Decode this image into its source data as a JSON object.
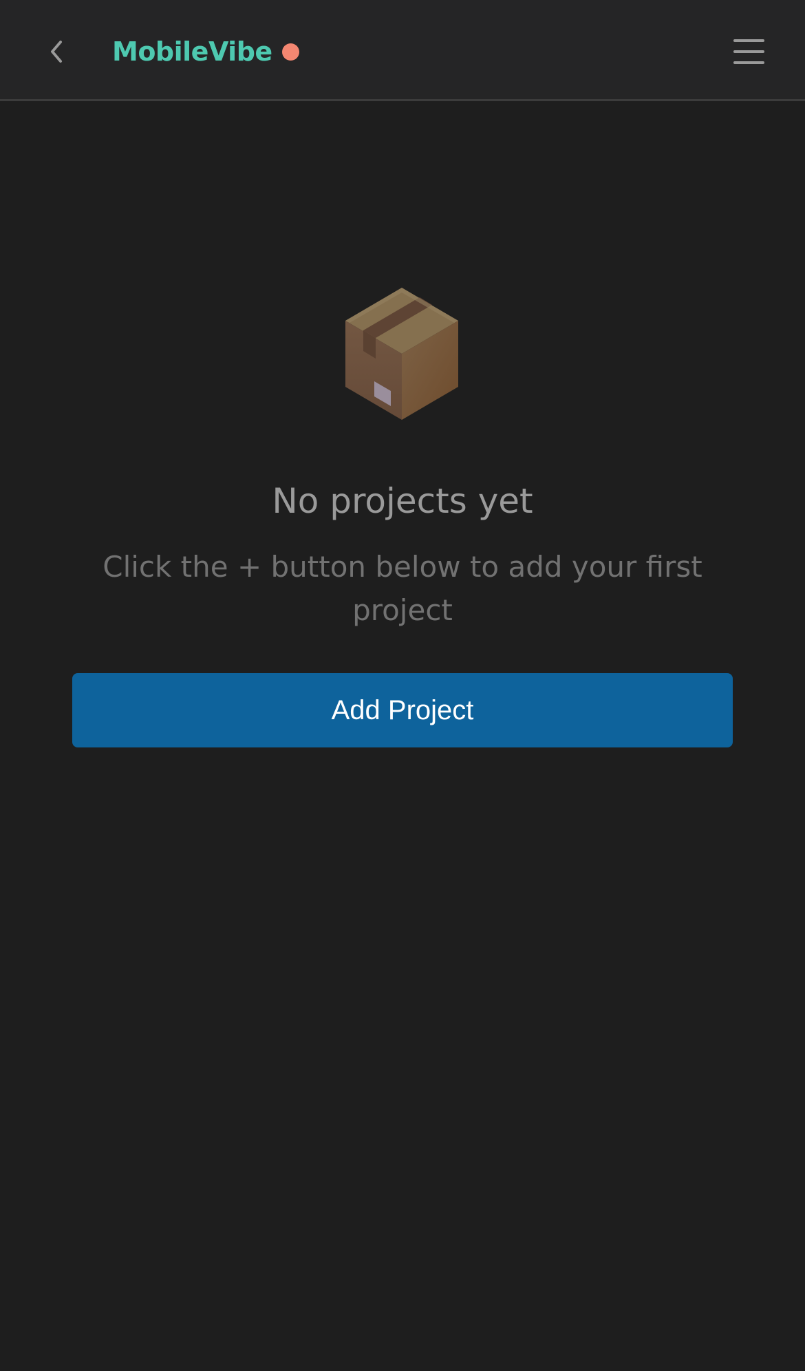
{
  "header": {
    "back_icon": "chevron-left-icon",
    "title": "MobileVibe",
    "title_color": "#4ec9b0",
    "status_dot_color": "#f48771",
    "menu_icon": "hamburger-menu-icon"
  },
  "empty_state": {
    "icon": "package-box-icon",
    "title": "No projects yet",
    "subtitle": "Click the + button below to add your first project"
  },
  "actions": {
    "add_project_label": "Add Project",
    "add_project_color": "#0e639c"
  },
  "colors": {
    "background": "#1e1e1e",
    "header_background": "#252526"
  }
}
